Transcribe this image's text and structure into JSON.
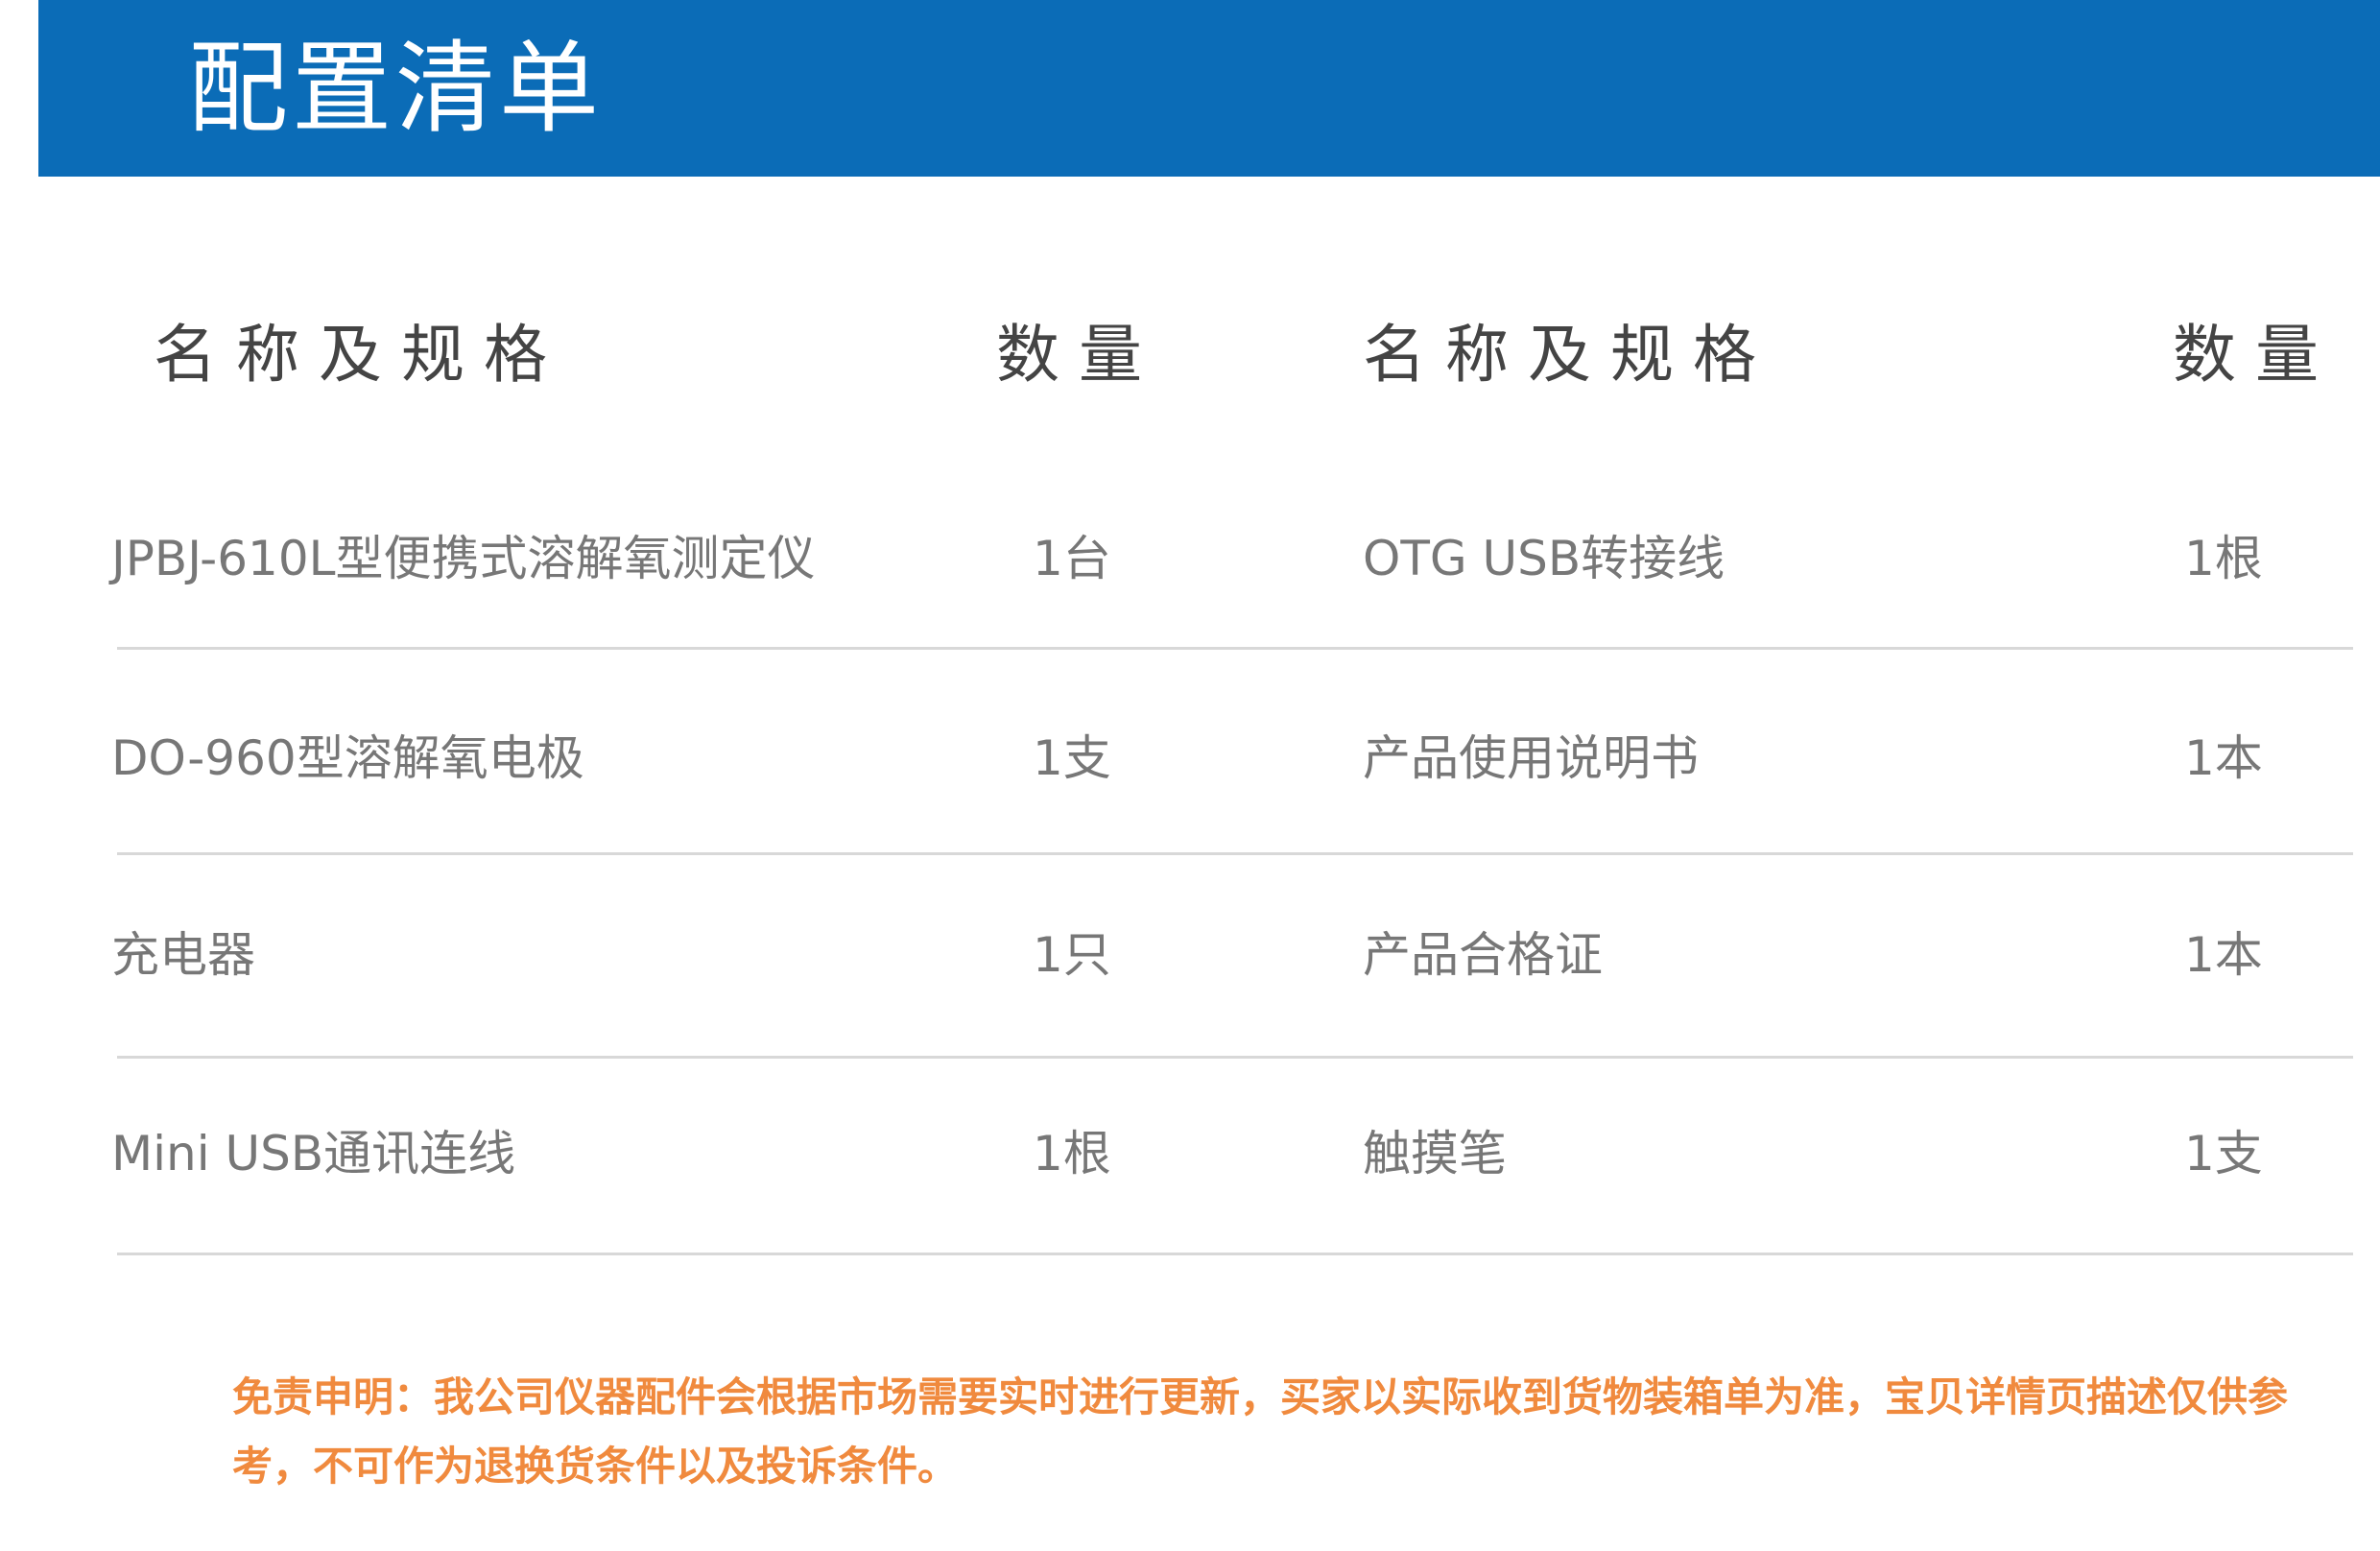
{
  "header": {
    "title": "配置清单"
  },
  "table": {
    "left_headers": {
      "name": "名称及规格",
      "qty": "数量"
    },
    "right_headers": {
      "name": "名称及规格",
      "qty": "数量"
    },
    "rows": [
      {
        "left_name": "JPBJ-610L型便携式溶解氧测定仪",
        "left_qty": "1台",
        "right_name": "OTG USB转接线",
        "right_qty": "1根"
      },
      {
        "left_name": "DO-960型溶解氧电极",
        "left_qty": "1支",
        "right_name": "产品使用说明书",
        "right_qty": "1本"
      },
      {
        "left_name": "充电器",
        "left_qty": "1只",
        "right_name": "产品合格证",
        "right_qty": "1本"
      },
      {
        "left_name": "Mini USB通讯连线",
        "left_qty": "1根",
        "right_name": "触摸笔",
        "right_qty": "1支"
      }
    ]
  },
  "disclaimer": {
    "text": "免责申明：我公司仪器配件会根据市场需要实时进行更新，买家以实际收到货物装箱单为准，宝贝详情页描述仅供参考，不可作为退换货条件以及投诉条件。"
  },
  "colors": {
    "header_bg": "#0b6cb7",
    "disclaimer": "#f08a3e"
  }
}
